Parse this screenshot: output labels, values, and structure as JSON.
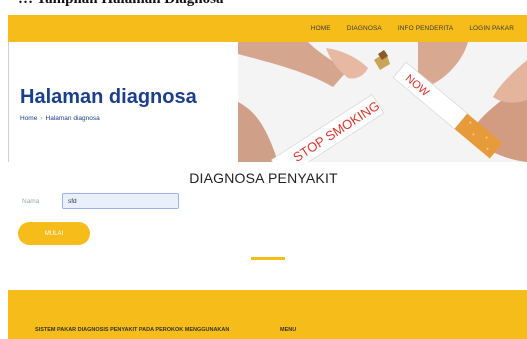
{
  "caption": "… Tampilan Halaman Diagnosa",
  "nav": {
    "items": [
      {
        "label": "HOME"
      },
      {
        "label": "DIAGNOSA"
      },
      {
        "label": "INFO PENDERITA"
      },
      {
        "label": "LOGIN PAKAR"
      }
    ]
  },
  "hero": {
    "title": "Halaman diagnosa",
    "breadcrumb_home": "Home",
    "breadcrumb_separator": "›",
    "breadcrumb_current": "Halaman diagnosa",
    "image_text_main": "STOP SMOKING",
    "image_text_now": "NOW"
  },
  "section": {
    "title": "DIAGNOSA PENYAKIT"
  },
  "form": {
    "name_label": "Nama",
    "name_value": "sfd"
  },
  "start_button": "MULAI",
  "footer": {
    "title": "SISTEM PAKAR DIAGNOSIS PENYAKIT PADA PEROKOK MENGGUNAKAN",
    "menu_label": "MENU"
  },
  "colors": {
    "accent": "#f6bd1a",
    "heading_blue": "#1b3f8b"
  }
}
